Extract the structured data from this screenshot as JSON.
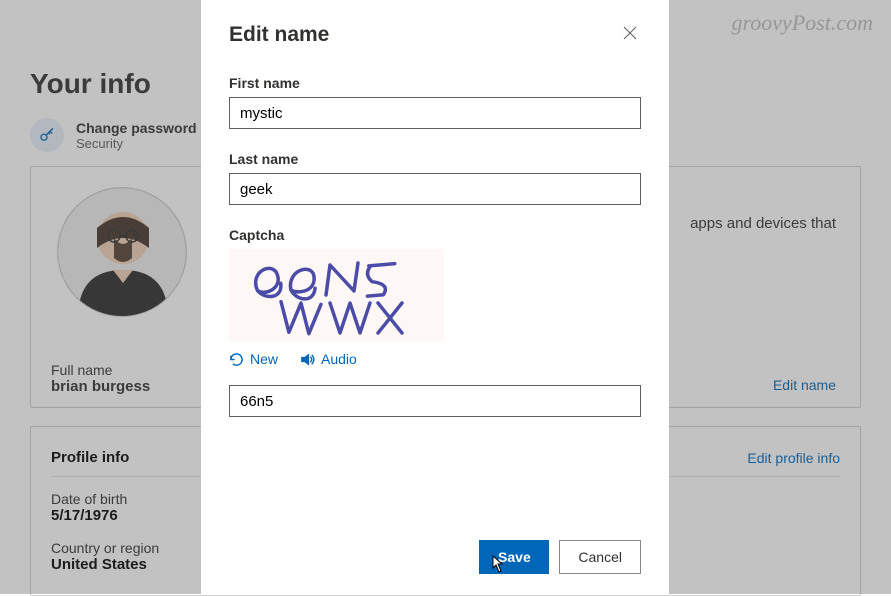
{
  "watermark": "groovyPost.com",
  "background": {
    "page_title": "Your info",
    "change_password": {
      "link": "Change password",
      "sub": "Security"
    },
    "full_name": {
      "label": "Full name",
      "value": "brian burgess"
    },
    "edit_name_link": "Edit name",
    "side_text": "apps and devices that",
    "profile_info": {
      "title": "Profile info",
      "edit_link": "Edit profile info",
      "dob": {
        "label": "Date of birth",
        "value": "5/17/1976"
      },
      "country": {
        "label": "Country or region",
        "value": "United States"
      }
    }
  },
  "modal": {
    "title": "Edit name",
    "first_name": {
      "label": "First name",
      "value": "mystic"
    },
    "last_name": {
      "label": "Last name",
      "value": "geek"
    },
    "captcha": {
      "label": "Captcha",
      "display_text": "66N5 VWX",
      "new_label": "New",
      "audio_label": "Audio",
      "input_value": "66n5"
    },
    "save_label": "Save",
    "cancel_label": "Cancel"
  }
}
